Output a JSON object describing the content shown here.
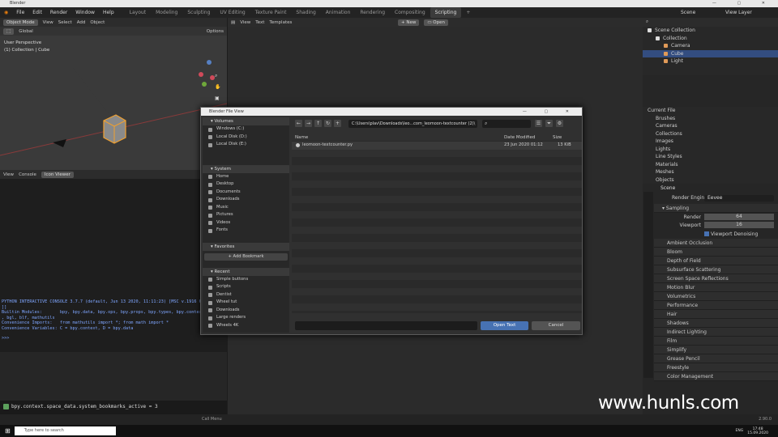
{
  "window": {
    "title": "Blender"
  },
  "menus": [
    "File",
    "Edit",
    "Render",
    "Window",
    "Help"
  ],
  "workspaces": [
    "Layout",
    "Modeling",
    "Sculpting",
    "UV Editing",
    "Texture Paint",
    "Shading",
    "Animation",
    "Rendering",
    "Compositing",
    "Scripting"
  ],
  "active_workspace": "Scripting",
  "scene": {
    "name": "Scene",
    "view_layer": "View Layer"
  },
  "viewport": {
    "mode": "Object Mode",
    "menus": [
      "View",
      "Select",
      "Add",
      "Object"
    ],
    "orientation": "Global",
    "options": "Options",
    "perspective": "User Perspective",
    "collection": "(1) Collection | Cube"
  },
  "console": {
    "menus": [
      "View",
      "Console"
    ],
    "icon_viewer": "Icon Viewer",
    "lines": [
      "PYTHON INTERACTIVE CONSOLE 3.7.7 (default, Jun 13 2020, 11:11:23) [MSC v.1916 64 bit",
      "]]",
      "",
      "Builtin Modules:       bpy, bpy.data, bpy.ops, bpy.props, bpy.types, bpy.context,",
      ", bgl, blf, mathutils",
      "Convenience Imports:   from mathutils import *; from math import *",
      "Convenience Variables: C = bpy.context, D = bpy.data"
    ],
    "prompt": ">>> ",
    "info": "bpy.context.space_data.system_bookmarks_active = 3"
  },
  "text_editor": {
    "menus": [
      "View",
      "Text",
      "Templates"
    ],
    "new": "New",
    "open": "Open"
  },
  "outliner": {
    "header": "Scene Collection",
    "rows": [
      {
        "label": "Collection",
        "indent": 1,
        "color": "#d0d0d0"
      },
      {
        "label": "Camera",
        "indent": 2,
        "color": "#e09a58"
      },
      {
        "label": "Cube",
        "indent": 2,
        "color": "#e09a58"
      },
      {
        "label": "Light",
        "indent": 2,
        "color": "#e09a58"
      }
    ]
  },
  "blend_file": {
    "header": "Current File",
    "rows": [
      "Brushes",
      "Cameras",
      "Collections",
      "Images",
      "Lights",
      "Line Styles",
      "Materials",
      "Meshes",
      "Objects"
    ]
  },
  "properties": {
    "scene": "Scene",
    "render_engine_label": "Render Engine",
    "render_engine": "Eevee",
    "sampling": "Sampling",
    "render_label": "Render",
    "render_value": "64",
    "viewport_label": "Viewport",
    "viewport_value": "16",
    "viewport_denoising": "Viewport Denoising",
    "panels": [
      "Ambient Occlusion",
      "Bloom",
      "Depth of Field",
      "Subsurface Scattering",
      "Screen Space Reflections",
      "Motion Blur",
      "Volumetrics",
      "Performance",
      "Hair",
      "Shadows",
      "Indirect Lighting",
      "Film",
      "Simplify",
      "Grease Pencil",
      "Freestyle",
      "Color Management"
    ]
  },
  "dialog": {
    "title": "Blender File View",
    "sections": {
      "volumes": {
        "title": "Volumes",
        "items": [
          "Windows (C:)",
          "Local Disk (D:)",
          "Local Disk (E:)"
        ]
      },
      "system": {
        "title": "System",
        "items": [
          "Home",
          "Desktop",
          "Documents",
          "Downloads",
          "Music",
          "Pictures",
          "Videos",
          "Fonts"
        ]
      },
      "favorites": {
        "title": "Favorites",
        "add": "Add Bookmark"
      },
      "recent": {
        "title": "Recent",
        "items": [
          "Simple buttons",
          "Scripts",
          "Dentist",
          "Wheel tut",
          "Downloads",
          "Large renders",
          "Wheels 4K"
        ]
      }
    },
    "path": "C:\\Users\\plav\\Downloads\\leo...com_leomoon-textcounter (2)\\",
    "columns": {
      "name": "Name",
      "date": "Date Modified",
      "size": "Size"
    },
    "files": [
      {
        "name": "leomoon-textcounter.py",
        "date": "23 Jun 2020 01:12",
        "size": "13 KiB"
      }
    ],
    "open_button": "Open Text",
    "cancel_button": "Cancel"
  },
  "statusbar": {
    "center": "Call Menu",
    "version": "2.90.0"
  },
  "taskbar": {
    "search": "Type here to search",
    "lang": "ENG",
    "time": "17:48",
    "date": "15.09.2020"
  },
  "watermark": "www.hunls.com"
}
